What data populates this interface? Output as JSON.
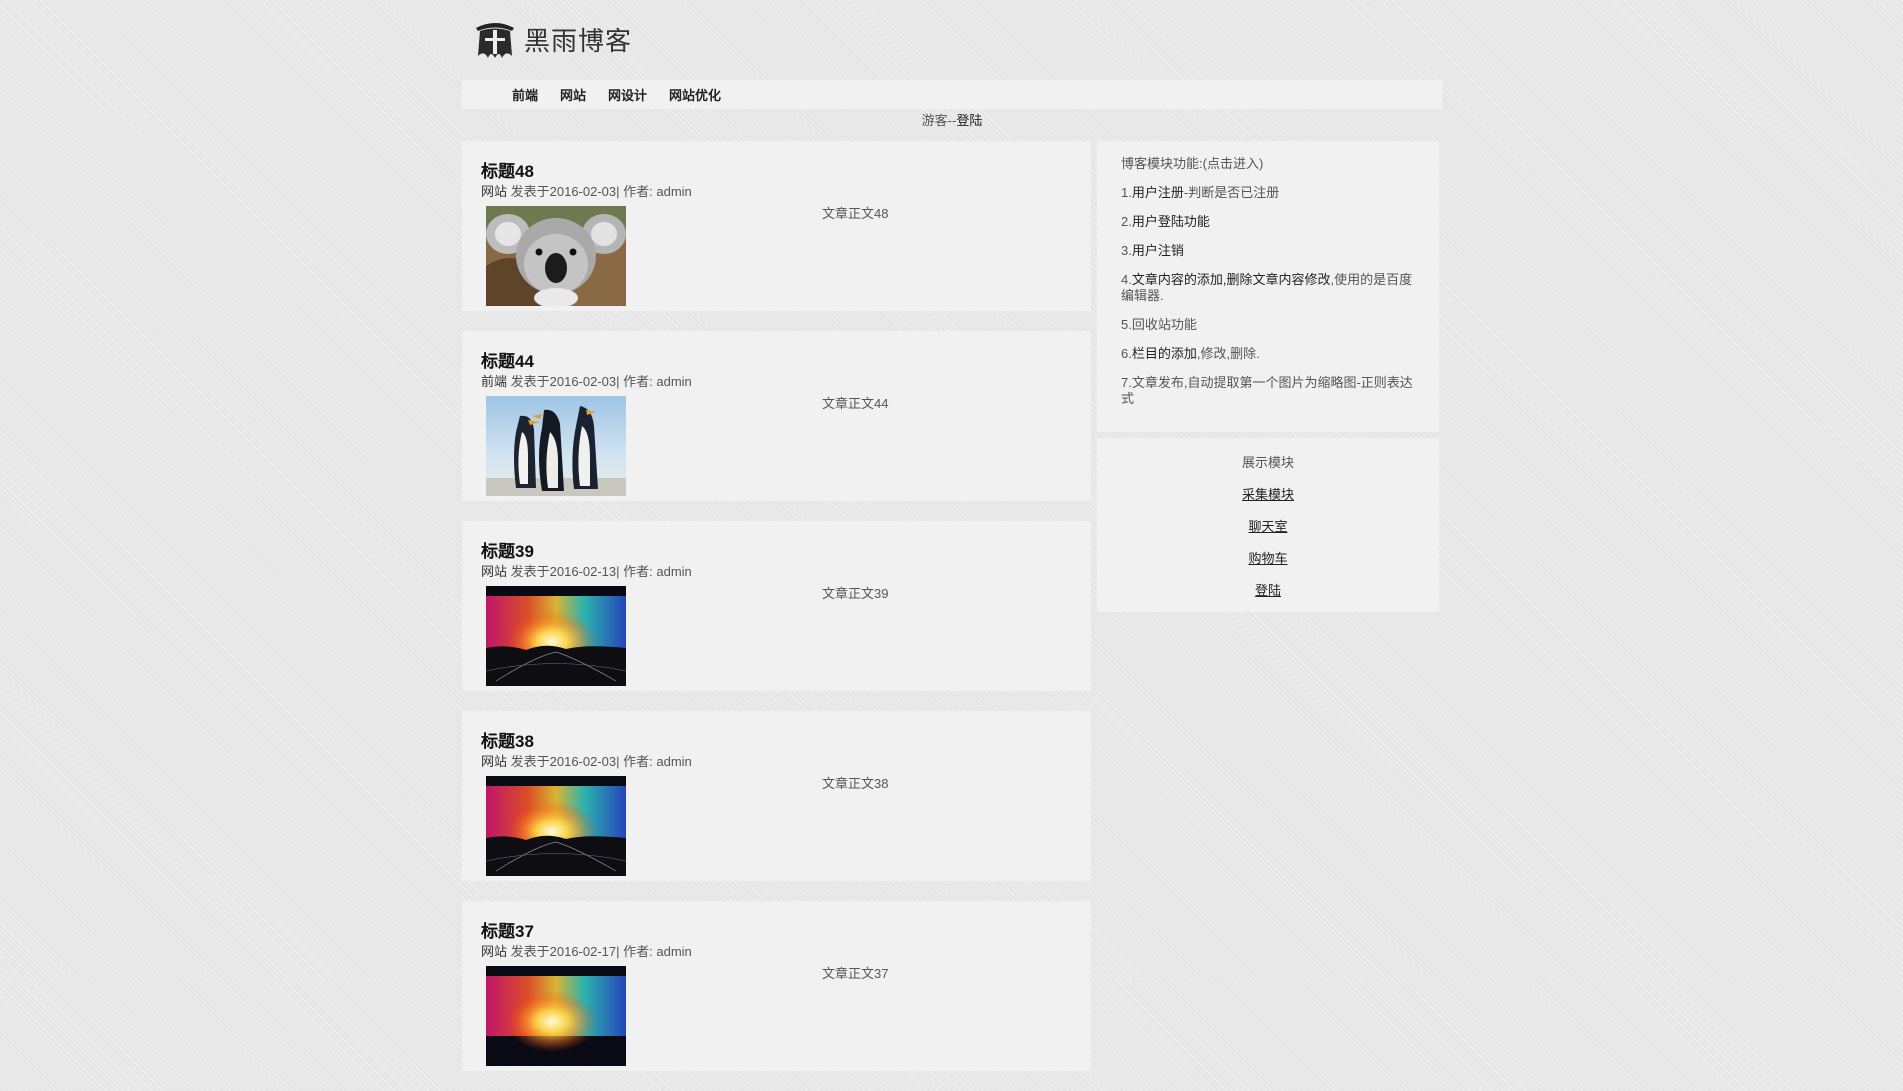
{
  "site": {
    "logo_text": "黑雨博客"
  },
  "nav": [
    "前端",
    "网站",
    "网设计",
    "网站优化"
  ],
  "login_bar": {
    "guest": "游客--",
    "login": "登陆"
  },
  "posts": [
    {
      "title": "标题48",
      "category": "网站",
      "date_text": "发表于2016-02-03",
      "sep": "|",
      "author_text": "作者: admin",
      "body": "文章正文48",
      "thumb": "koala-photo"
    },
    {
      "title": "标题44",
      "category": "前端",
      "date_text": "发表于2016-02-03",
      "sep": "|",
      "author_text": "作者: admin",
      "body": "文章正文44",
      "thumb": "penguins-photo"
    },
    {
      "title": "标题39",
      "category": "网站",
      "date_text": "发表于2016-02-13",
      "sep": "|",
      "author_text": "作者: admin",
      "body": "文章正文39",
      "thumb": "rainbow-sunset-photo"
    },
    {
      "title": "标题38",
      "category": "网站",
      "date_text": "发表于2016-02-03",
      "sep": "|",
      "author_text": "作者: admin",
      "body": "文章正文38",
      "thumb": "rainbow-sunset-photo"
    },
    {
      "title": "标题37",
      "category": "网站",
      "date_text": "发表于2016-02-17",
      "sep": "|",
      "author_text": "作者: admin",
      "body": "文章正文37",
      "thumb": "rainbow-sunset-photo"
    }
  ],
  "features": {
    "title": "博客模块功能:(点击进入)",
    "items": [
      {
        "prefix": "1.",
        "link": "用户注册",
        "rest": "-判断是否已注册"
      },
      {
        "prefix": "2.",
        "link": "用户登陆功能",
        "rest": ""
      },
      {
        "prefix": "3.",
        "link": "用户注销",
        "rest": ""
      },
      {
        "prefix": "4.",
        "link": "文章内容的添加,删除文章内容修改",
        "rest": ",使用的是百度编辑器."
      },
      {
        "prefix": "5.",
        "link": "",
        "rest": "回收站功能"
      },
      {
        "prefix": "6.",
        "link": "栏目的添加",
        "rest": ",修改,删除."
      },
      {
        "prefix": "7.",
        "link": "",
        "rest": "文章发布,自动提取第一个图片为缩略图-正则表达式"
      }
    ]
  },
  "modules": {
    "title": "展示模块",
    "links": [
      "采集模块",
      "聊天室",
      "购物车",
      "登陆"
    ]
  }
}
